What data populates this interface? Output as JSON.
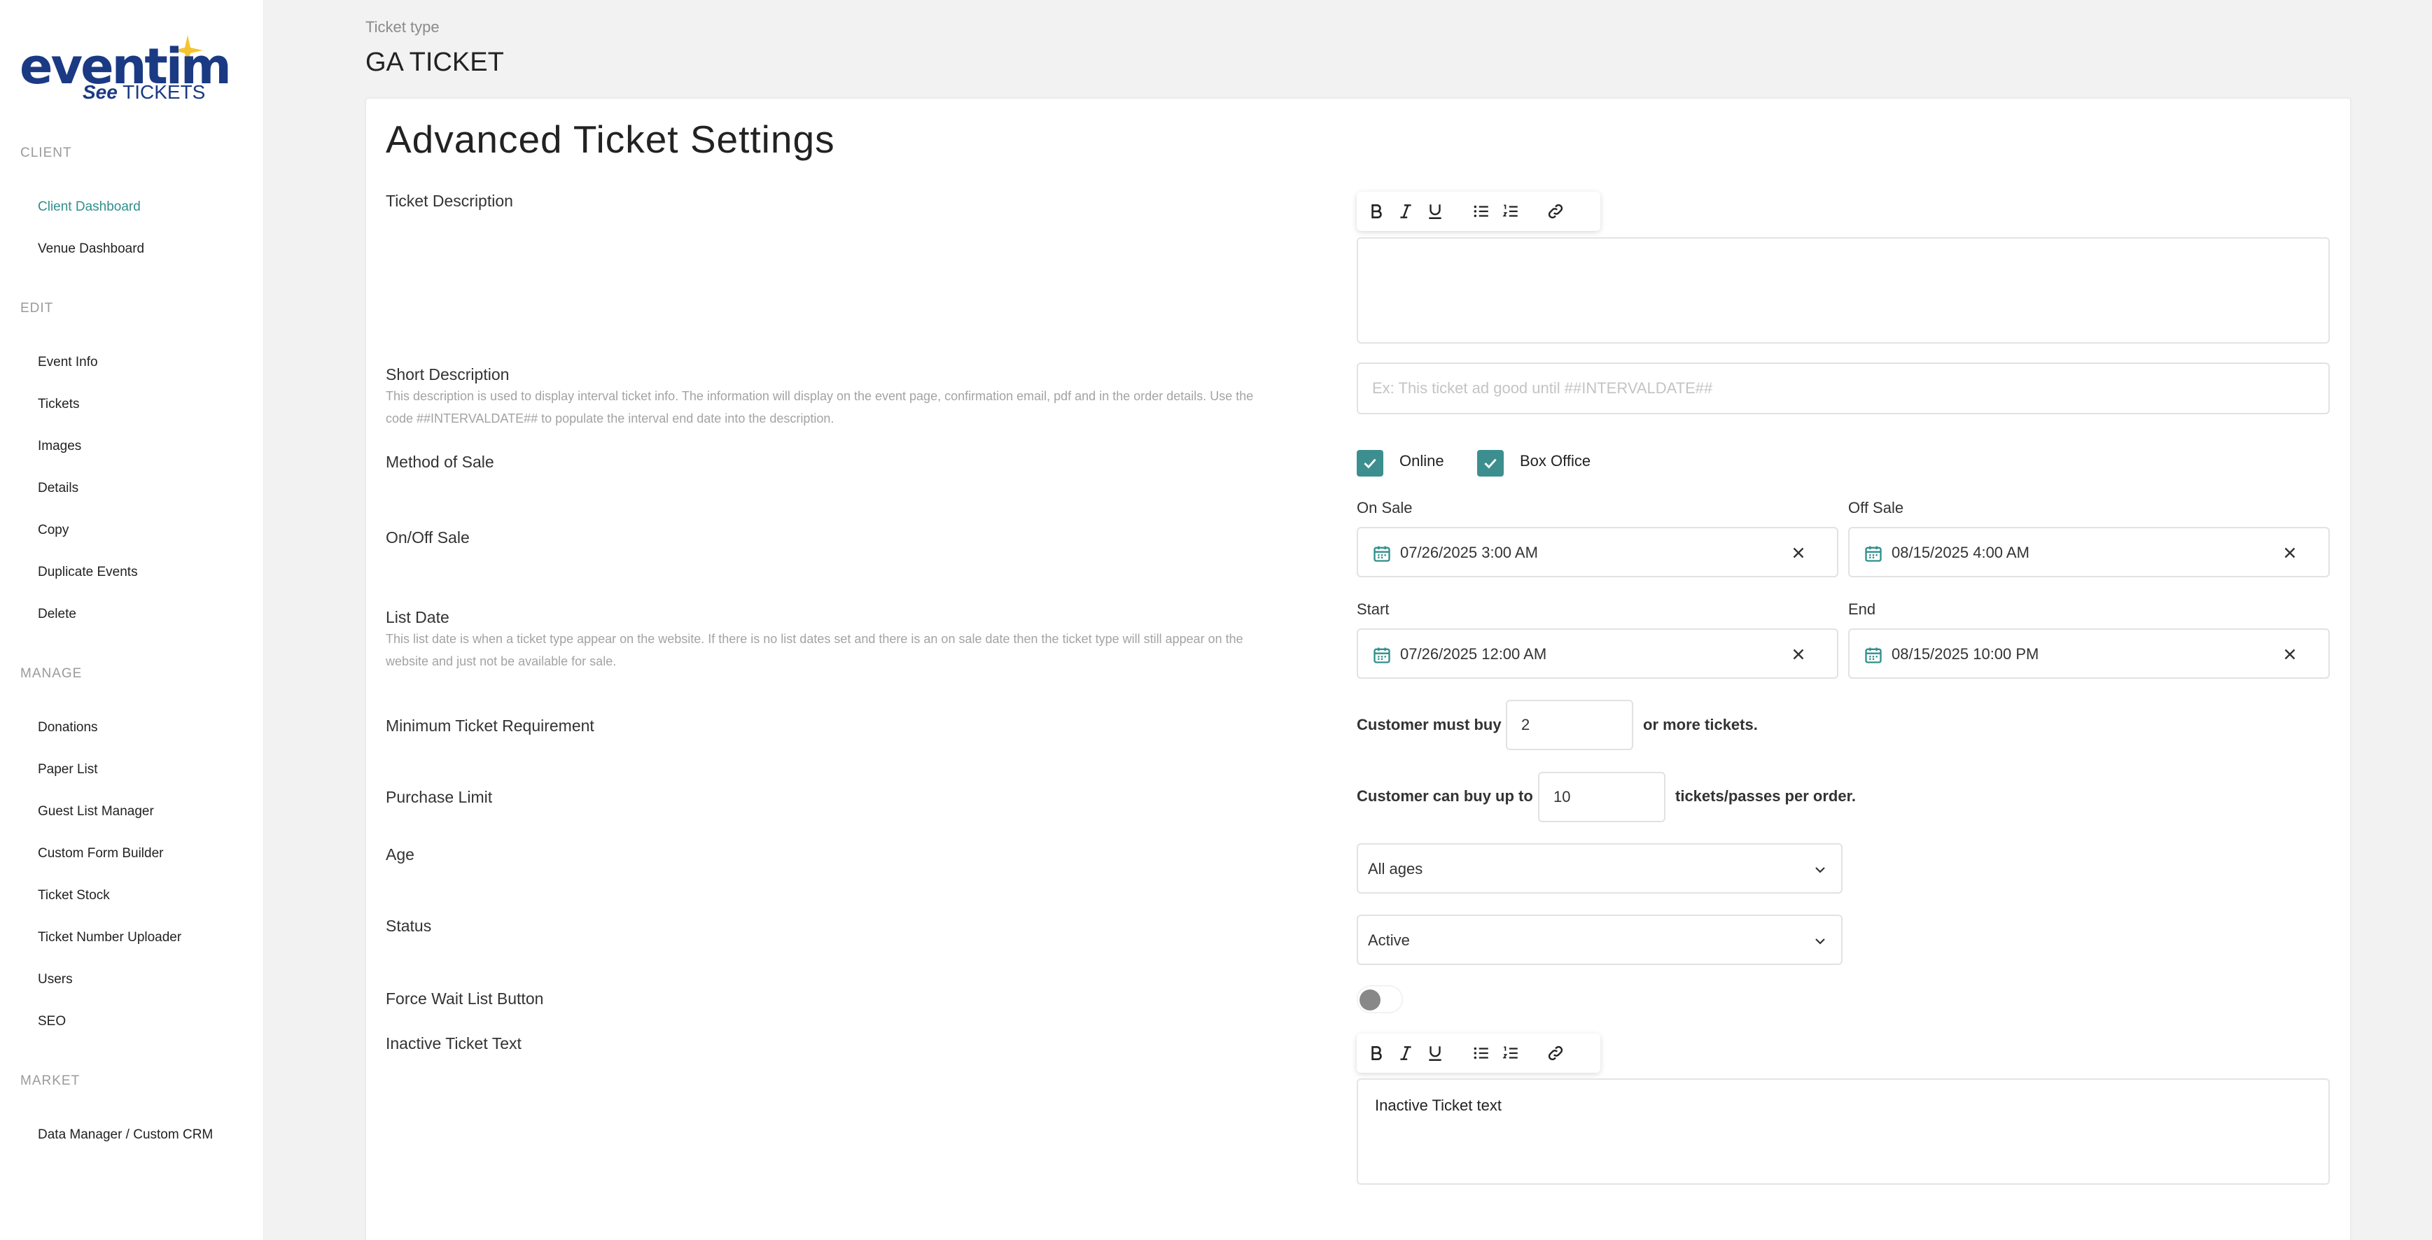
{
  "brand": {
    "logo_word": "eventim",
    "logo_sub_see": "See",
    "logo_sub_tickets": "TICKETS",
    "logo_color": "#1b3a84",
    "star_color": "#f4c430"
  },
  "sidebar": {
    "sections": [
      {
        "title": "CLIENT",
        "items": [
          "Client Dashboard",
          "Venue Dashboard"
        ]
      },
      {
        "title": "EDIT",
        "items": [
          "Event Info",
          "Tickets",
          "Images",
          "Details",
          "Copy",
          "Duplicate Events",
          "Delete"
        ]
      },
      {
        "title": "MANAGE",
        "items": [
          "Donations",
          "Paper List",
          "Guest List Manager",
          "Custom Form Builder",
          "Ticket Stock",
          "Ticket Number Uploader",
          "Users",
          "SEO"
        ]
      },
      {
        "title": "MARKET",
        "items": [
          "Data Manager / Custom CRM"
        ]
      }
    ],
    "active_item": "Client Dashboard",
    "active_color": "#2f8f8c"
  },
  "header": {
    "ticket_type_label": "Ticket type",
    "ticket_type_value": "GA TICKET"
  },
  "card": {
    "title": "Advanced Ticket Settings"
  },
  "fields": {
    "ticket_description": {
      "label": "Ticket Description",
      "value": ""
    },
    "short_description": {
      "label": "Short Description",
      "help": "This description is used to display interval ticket info. The information will display on the event page, confirmation email, pdf and in the order details. Use the code ##INTERVALDATE## to populate the interval end date into the description.",
      "placeholder": "Ex: This ticket ad good until ##INTERVALDATE##",
      "value": ""
    },
    "method_of_sale": {
      "label": "Method of Sale",
      "options": [
        {
          "label": "Online",
          "checked": true
        },
        {
          "label": "Box Office",
          "checked": true
        }
      ]
    },
    "on_off_sale": {
      "label": "On/Off Sale",
      "on_label": "On Sale",
      "on_value": "07/26/2025 3:00 AM",
      "off_label": "Off Sale",
      "off_value": "08/15/2025 4:00 AM"
    },
    "list_date": {
      "label": "List Date",
      "help": "This list date is when a ticket type appear on the website. If there is no list dates set and there is an on sale date then the ticket type will still appear on the website and just not be available for sale.",
      "start_label": "Start",
      "start_value": "07/26/2025 12:00 AM",
      "end_label": "End",
      "end_value": "08/15/2025 10:00 PM"
    },
    "minimum_ticket": {
      "label": "Minimum Ticket Requirement",
      "prefix": "Customer must buy",
      "value": "2",
      "suffix": "or more tickets."
    },
    "purchase_limit": {
      "label": "Purchase Limit",
      "prefix": "Customer can buy up to",
      "value": "10",
      "suffix": "tickets/passes per order."
    },
    "age": {
      "label": "Age",
      "value": "All ages"
    },
    "status": {
      "label": "Status",
      "value": "Active"
    },
    "force_wait_list": {
      "label": "Force Wait List Button",
      "enabled": false
    },
    "inactive_ticket_text": {
      "label": "Inactive Ticket Text",
      "value": "Inactive Ticket text"
    }
  },
  "colors": {
    "checkbox": "#3d8f8f",
    "accent": "#2f8f8c"
  }
}
